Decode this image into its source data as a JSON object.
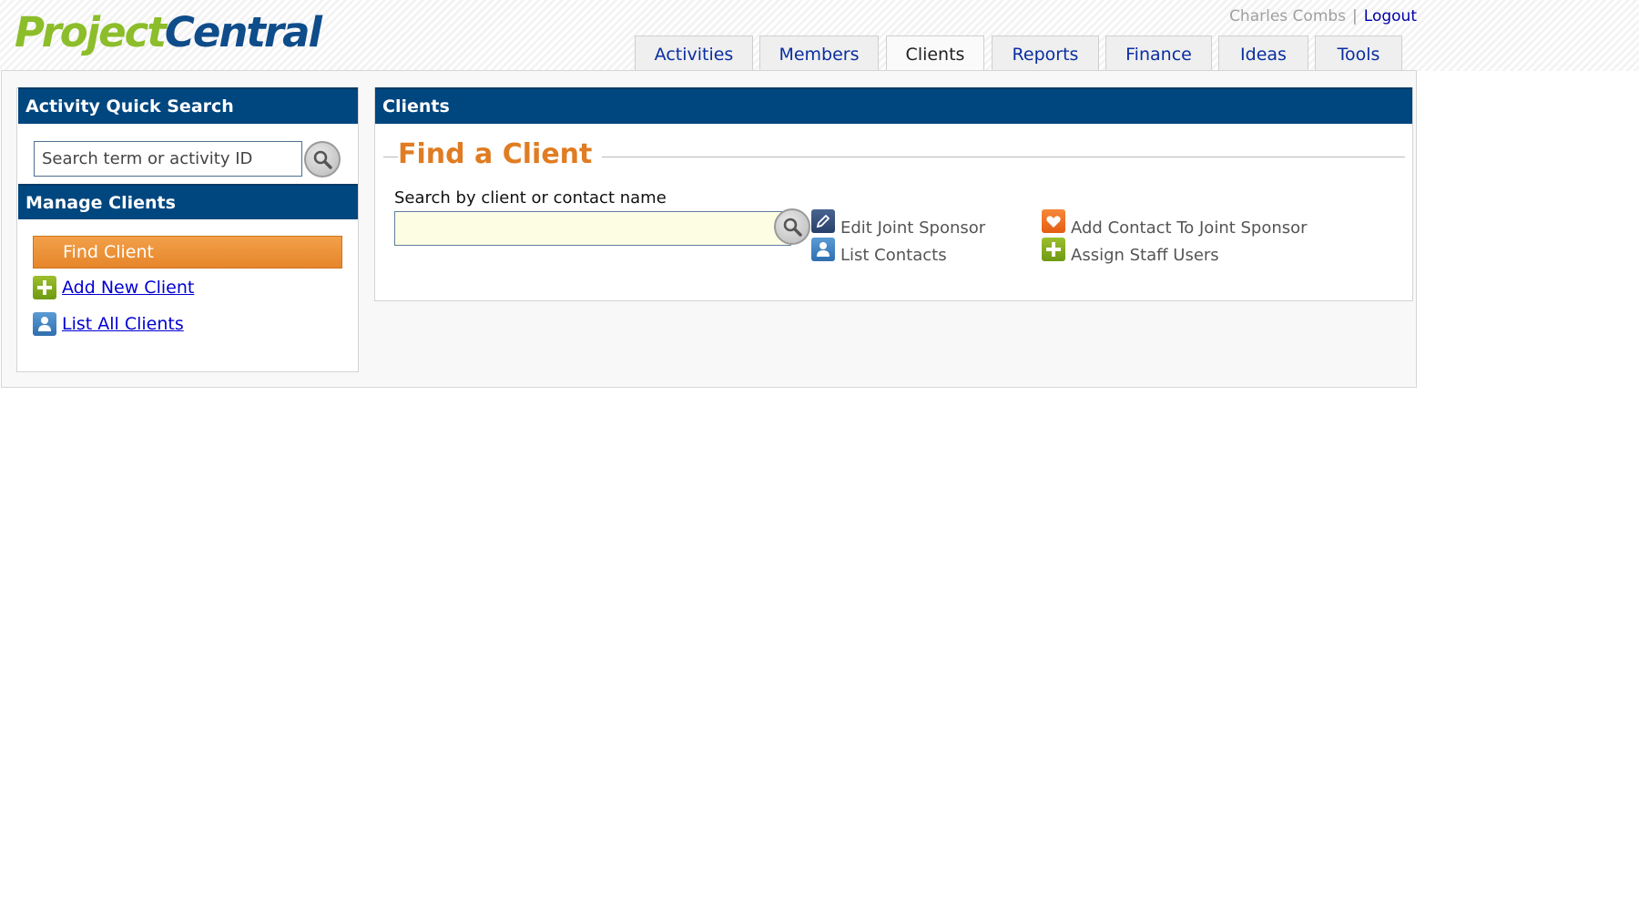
{
  "brand": {
    "part1": "Project",
    "part2": "Central"
  },
  "user": {
    "name": "Charles Combs",
    "separator": "|",
    "logout": "Logout"
  },
  "tabs": [
    {
      "label": "Activities"
    },
    {
      "label": "Members"
    },
    {
      "label": "Clients",
      "active": true
    },
    {
      "label": "Reports"
    },
    {
      "label": "Finance"
    },
    {
      "label": "Ideas"
    },
    {
      "label": "Tools"
    }
  ],
  "quick_search": {
    "title": "Activity Quick Search",
    "placeholder": "Search term or activity ID"
  },
  "manage_clients": {
    "title": "Manage Clients",
    "find_client": "Find Client",
    "add_new_client": "Add New Client",
    "list_all_clients": "List All Clients"
  },
  "clients": {
    "title": "Clients",
    "section_title": "Find a Client",
    "search_label": "Search by client or contact name",
    "search_value": "",
    "actions": {
      "edit_joint_sponsor": "Edit Joint Sponsor",
      "list_contacts": "List Contacts",
      "add_contact_joint_sponsor": "Add Contact To Joint Sponsor",
      "assign_staff_users": "Assign Staff Users"
    }
  },
  "colors": {
    "header_blue": "#00467f",
    "accent_orange": "#e07c22",
    "link_blue": "#0000d0",
    "logo_green": "#8cbd2a"
  }
}
